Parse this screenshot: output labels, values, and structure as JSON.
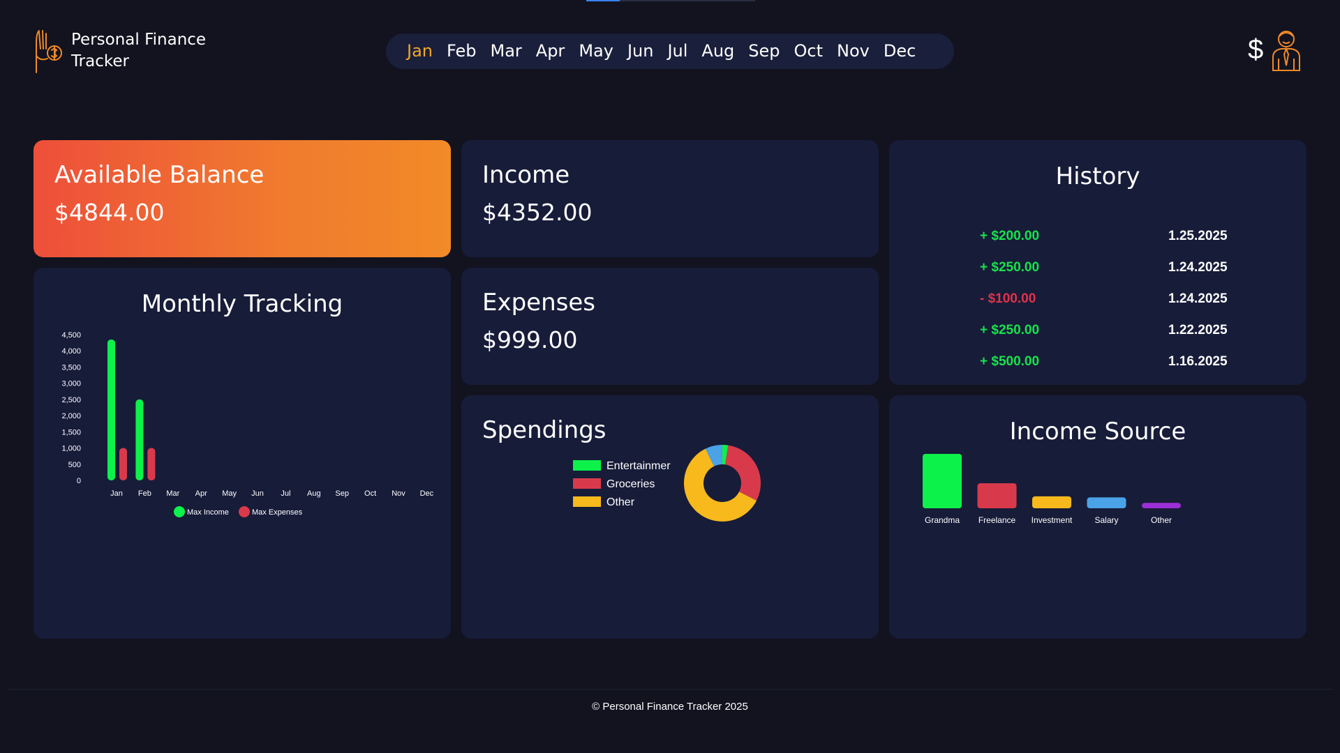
{
  "app": {
    "title": "Personal Finance Tracker",
    "logo_icon": "hand-coin-icon",
    "profile_currency": "$",
    "profile_icon": "businessman-avatar-icon"
  },
  "months": [
    "Jan",
    "Feb",
    "Mar",
    "Apr",
    "May",
    "Jun",
    "Jul",
    "Aug",
    "Sep",
    "Oct",
    "Nov",
    "Dec"
  ],
  "active_month": "Jan",
  "balance": {
    "label": "Available Balance",
    "value": "$4844.00"
  },
  "income": {
    "label": "Income",
    "value": "$4352.00"
  },
  "expenses": {
    "label": "Expenses",
    "value": "$999.00"
  },
  "history": {
    "title": "History",
    "items": [
      {
        "amount": "+ $200.00",
        "date": "1.25.2025",
        "kind": "income"
      },
      {
        "amount": "+ $250.00",
        "date": "1.24.2025",
        "kind": "income"
      },
      {
        "amount": "- $100.00",
        "date": "1.24.2025",
        "kind": "expense"
      },
      {
        "amount": "+ $250.00",
        "date": "1.22.2025",
        "kind": "income"
      },
      {
        "amount": "+ $500.00",
        "date": "1.16.2025",
        "kind": "income"
      }
    ]
  },
  "monthly_tracking": {
    "title": "Monthly Tracking"
  },
  "spendings": {
    "title": "Spendings"
  },
  "income_source": {
    "title": "Income Source"
  },
  "colors": {
    "green": "#0cf24a",
    "red": "#d93a4b",
    "yellow": "#f7b91c",
    "blue": "#4aa3e6",
    "purple": "#9b2fd6",
    "accent": "#f4a62a"
  },
  "chart_data": [
    {
      "type": "bar",
      "categories": [
        "Jan",
        "Feb",
        "Mar",
        "Apr",
        "May",
        "Jun",
        "Jul",
        "Aug",
        "Sep",
        "Oct",
        "Nov",
        "Dec"
      ],
      "series": [
        {
          "name": "Max Income",
          "values": [
            4350,
            2500,
            0,
            0,
            0,
            0,
            0,
            0,
            0,
            0,
            0,
            0
          ]
        },
        {
          "name": "Max Expenses",
          "values": [
            1000,
            1000,
            0,
            0,
            0,
            0,
            0,
            0,
            0,
            0,
            0,
            0
          ]
        }
      ],
      "yticks": [
        "0",
        "500",
        "1,000",
        "1,500",
        "2,000",
        "2,500",
        "3,000",
        "3,500",
        "4,000",
        "4,500"
      ],
      "ylim": [
        0,
        4500
      ],
      "legend": "bottom"
    },
    {
      "type": "pie",
      "labels": [
        "Entertainmer",
        "Groceries",
        "Other"
      ],
      "values": [
        100,
        250,
        500
      ],
      "extra_slices": [
        {
          "value": 60
        },
        {
          "value": 20
        }
      ],
      "legend": "left"
    },
    {
      "type": "bar",
      "categories": [
        "Grandma",
        "Freelance",
        "Investment",
        "Salary",
        "Other"
      ],
      "values": [
        2500,
        1150,
        550,
        500,
        250
      ],
      "ylim": [
        0,
        2500
      ]
    }
  ],
  "footer": {
    "text": "© Personal Finance Tracker 2025"
  }
}
